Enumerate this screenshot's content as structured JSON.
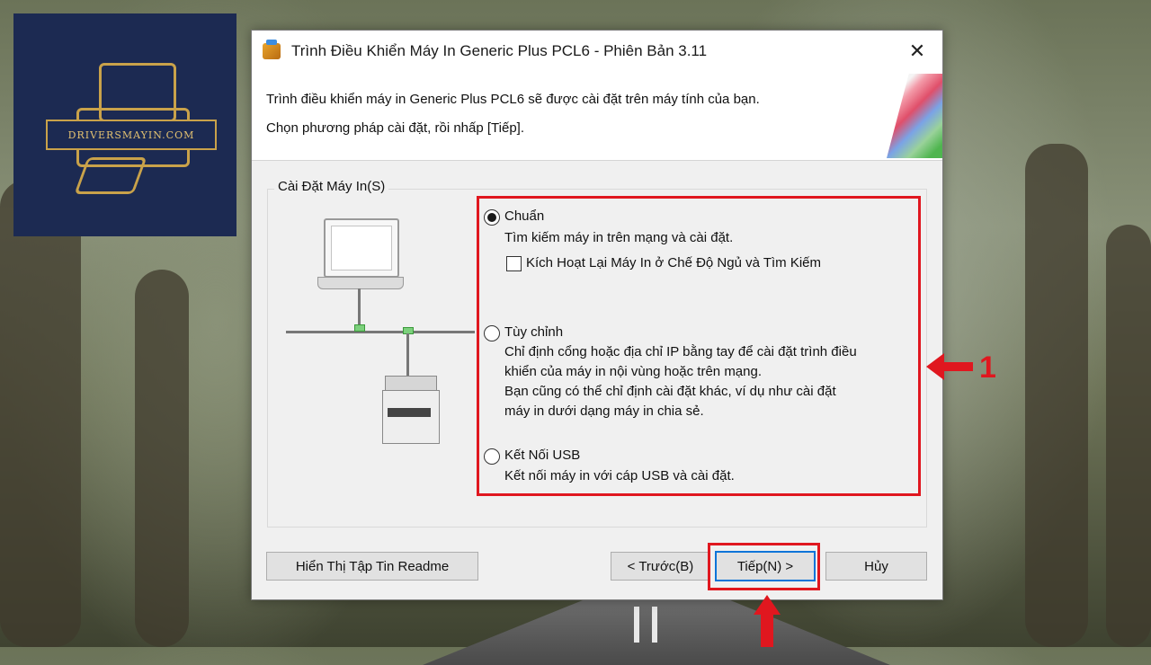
{
  "logo": {
    "text": "DRIVERSMAYIN.COM"
  },
  "dialog": {
    "title": "Trình Điều Khiển Máy In Generic Plus PCL6 - Phiên Bản 3.11",
    "close_glyph": "✕",
    "header_line1": "Trình điều khiển máy in Generic Plus PCL6 sẽ được cài đặt trên máy tính của bạn.",
    "header_line2": "Chọn phương pháp cài đặt, rồi nhấp [Tiếp].",
    "group_label": "Cài Đặt Máy In(S)",
    "options": [
      {
        "label": "Chuẩn",
        "selected": true,
        "desc": [
          "Tìm kiếm máy in trên mạng và cài đặt."
        ],
        "checkbox_label": "Kích Hoạt Lại Máy In ở Chế Độ Ngủ và Tìm Kiếm",
        "checkbox_checked": false
      },
      {
        "label": "Tùy chỉnh",
        "selected": false,
        "desc": [
          "Chỉ định cổng hoặc địa chỉ IP bằng tay để cài đặt trình điều",
          "khiển của máy in nội vùng hoặc trên mạng.",
          "Bạn cũng có thể chỉ định cài đặt khác, ví dụ như cài đặt",
          "máy in dưới dạng máy in chia sẻ."
        ]
      },
      {
        "label": "Kết Nối USB",
        "selected": false,
        "desc": [
          "Kết nối máy in với cáp USB và cài đặt."
        ]
      }
    ],
    "buttons": {
      "readme": "Hiển Thị Tập Tin Readme",
      "back": "< Trước(B)",
      "next": "Tiếp(N) >",
      "cancel": "Hủy"
    }
  },
  "annotation": {
    "label": "1",
    "color": "#e0171f"
  }
}
